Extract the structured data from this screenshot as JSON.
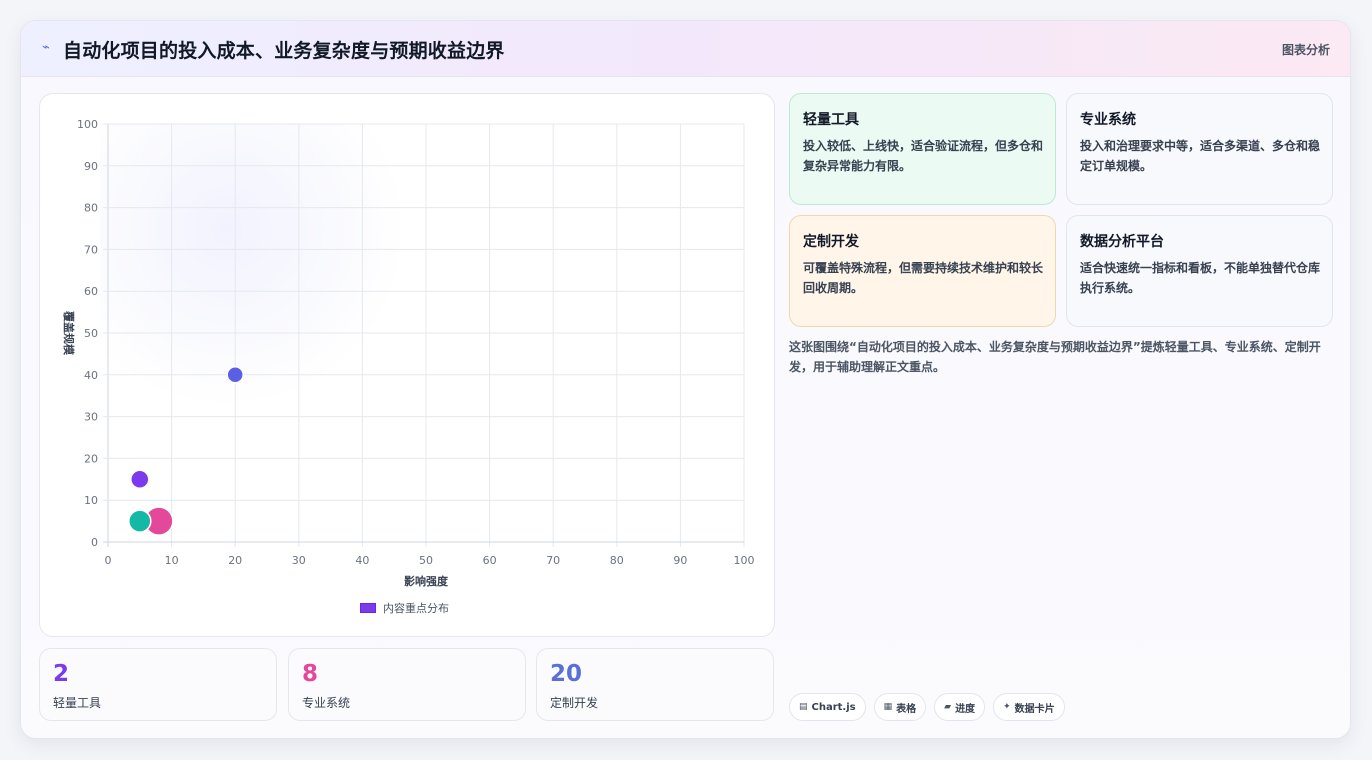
{
  "header": {
    "title": "自动化项目的投入成本、业务复杂度与预期收益边界",
    "tag": "图表分析"
  },
  "chart_data": {
    "type": "scatter",
    "xlabel": "影响强度",
    "ylabel": "覆盖规模",
    "xlim": [
      0,
      100
    ],
    "ylim": [
      0,
      100
    ],
    "x_ticks": [
      "0",
      "10",
      "20",
      "30",
      "40",
      "50",
      "60",
      "70",
      "80",
      "90",
      "100"
    ],
    "y_ticks": [
      "0",
      "10",
      "20",
      "30",
      "40",
      "50",
      "60",
      "70",
      "80",
      "90",
      "100"
    ],
    "grid": true,
    "legend_position": "bottom",
    "series": [
      {
        "name": "内容重点分布",
        "points": [
          {
            "x": 20,
            "y": 40,
            "r": 8,
            "color": "#5b5fe3"
          },
          {
            "x": 5,
            "y": 15,
            "r": 9,
            "color": "#7c3aed"
          },
          {
            "x": 8,
            "y": 5,
            "r": 14,
            "color": "#e4489b"
          },
          {
            "x": 5,
            "y": 5,
            "r": 11,
            "color": "#14b8a6"
          }
        ]
      }
    ]
  },
  "stats": [
    {
      "value": "2",
      "label": "轻量工具",
      "color": "#7c3aed"
    },
    {
      "value": "8",
      "label": "专业系统",
      "color": "#e4489b"
    },
    {
      "value": "20",
      "label": "定制开发",
      "color": "#5b6fd9"
    }
  ],
  "cards": [
    {
      "title": "轻量工具",
      "desc": "投入较低、上线快，适合验证流程，但多仓和复杂异常能力有限。",
      "bg": "#ebfaf2",
      "border": "#bfe8d1"
    },
    {
      "title": "专业系统",
      "desc": "投入和治理要求中等，适合多渠道、多仓和稳定订单规模。",
      "bg": "#f8f9fd",
      "border": "#e2e5f0"
    },
    {
      "title": "定制开发",
      "desc": "可覆盖特殊流程，但需要持续技术维护和较长回收周期。",
      "bg": "#fff6e9",
      "border": "#f2d7ad"
    },
    {
      "title": "数据分析平台",
      "desc": "适合快速统一指标和看板，不能单独替代仓库执行系统。",
      "bg": "#f8f9fd",
      "border": "#e2e5f0"
    }
  ],
  "note": "这张图围绕“自动化项目的投入成本、业务复杂度与预期收益边界”提炼轻量工具、专业系统、定制开发，用于辅助理解正文重点。",
  "chips": [
    {
      "icon": "chart-icon",
      "glyph": "▤",
      "label": "Chart.js"
    },
    {
      "icon": "table-icon",
      "glyph": "▦",
      "label": "表格"
    },
    {
      "icon": "progress-icon",
      "glyph": "▰",
      "label": "进度"
    },
    {
      "icon": "card-icon",
      "glyph": "✦",
      "label": "数据卡片"
    }
  ]
}
